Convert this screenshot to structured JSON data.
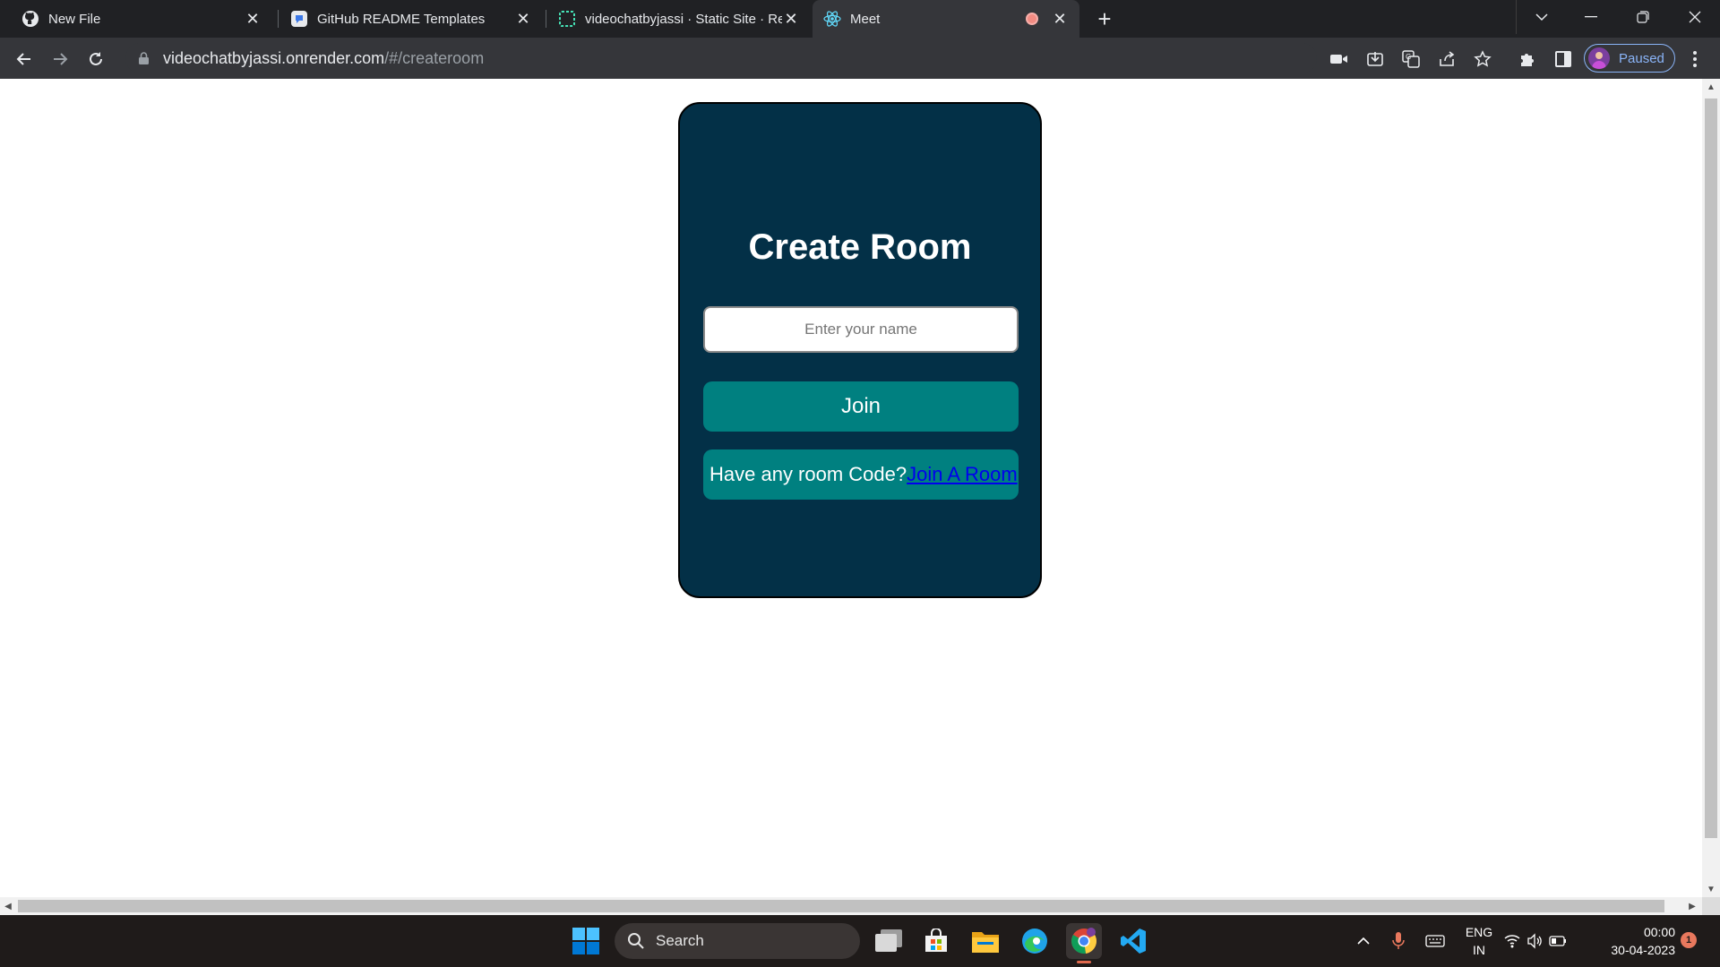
{
  "browser": {
    "tabs": [
      {
        "title": "New File",
        "icon": "github-icon"
      },
      {
        "title": "GitHub README Templates",
        "icon": "readme-templates-icon"
      },
      {
        "title": "videochatbyjassi · Static Site · Re",
        "icon": "render-icon"
      },
      {
        "title": "Meet",
        "icon": "react-icon",
        "recording": true
      }
    ],
    "url": {
      "host": "videochatbyjassi.onrender.com",
      "path": "/#/createroom"
    },
    "profile_label": "Paused"
  },
  "page": {
    "title": "Create Room",
    "name_placeholder": "Enter your name",
    "join_label": "Join",
    "room_code_prompt": "Have any room Code?",
    "join_room_link": "Join A Room"
  },
  "taskbar": {
    "search_label": "Search",
    "lang_line1": "ENG",
    "lang_line2": "IN",
    "time": "00:00",
    "date": "30-04-2023",
    "notification_count": "1"
  },
  "colors": {
    "card_bg": "#033047",
    "button_bg": "#008080",
    "link": "#0000ee"
  }
}
